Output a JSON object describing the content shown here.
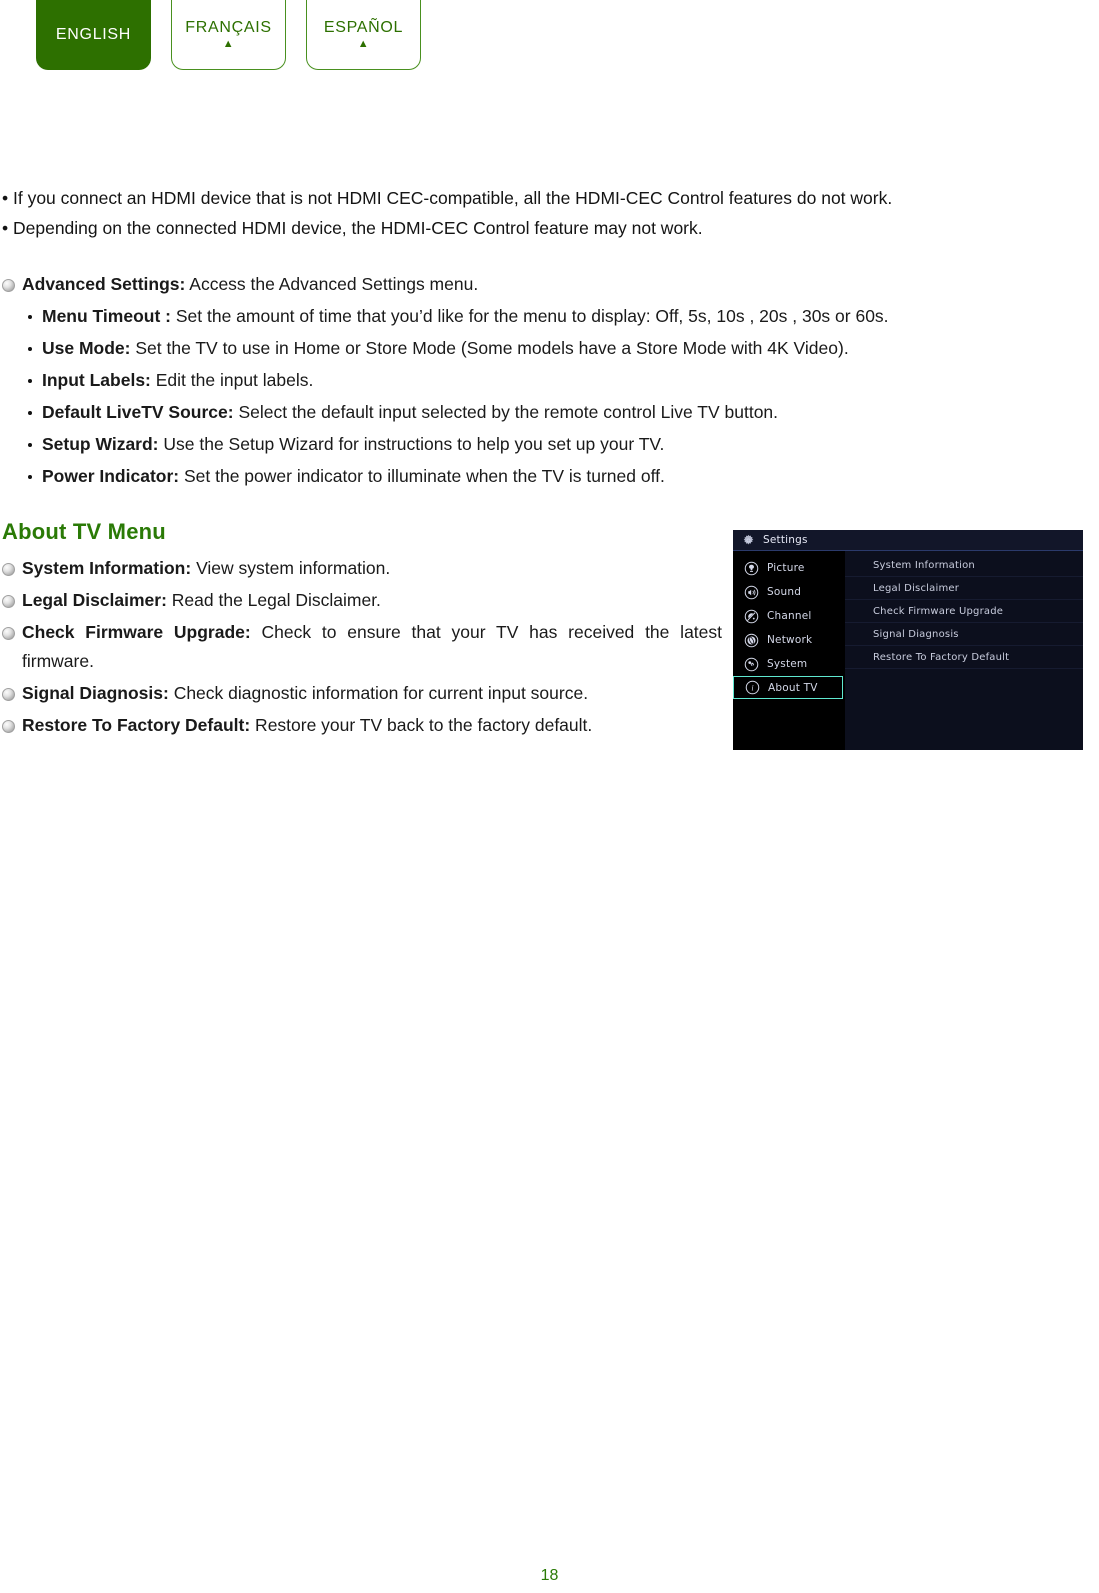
{
  "language_tabs": [
    {
      "label": "ENGLISH",
      "active": true,
      "arrow": ""
    },
    {
      "label": "FRANÇAIS",
      "active": false,
      "arrow": "▲"
    },
    {
      "label": "ESPAÑOL",
      "active": false,
      "arrow": "▲"
    }
  ],
  "notes": [
    "• If you connect an HDMI device that is not HDMI CEC-compatible, all the HDMI-CEC Control features do not work.",
    "• Depending on the connected HDMI device, the HDMI-CEC Control feature may not work."
  ],
  "advanced_settings": {
    "term": "Advanced Settings:",
    "description": " Access the Advanced Settings menu.",
    "sub_items": [
      {
        "term": "Menu Timeout :",
        "description": " Set the amount of time that you’d like for the menu to display: Off, 5s, 10s , 20s , 30s or 60s."
      },
      {
        "term": "Use Mode:",
        "description": " Set the TV to use in Home or Store Mode (Some models have a Store Mode with 4K Video)."
      },
      {
        "term": "Input Labels:",
        "description": " Edit the input labels."
      },
      {
        "term": "Default LiveTV Source:",
        "description": " Select the default input selected by the remote control Live TV button."
      },
      {
        "term": "Setup Wizard:",
        "description": " Use the Setup Wizard for instructions to help you set up your TV."
      },
      {
        "term": "Power Indicator:",
        "description": " Set the power indicator to illuminate when the TV is turned off."
      }
    ]
  },
  "about_tv_section": {
    "title": "About TV Menu",
    "items": [
      {
        "term": "System Information:",
        "description": " View system information."
      },
      {
        "term": "Legal Disclaimer:",
        "description": " Read the Legal Disclaimer."
      },
      {
        "term": "Check Firmware Upgrade:",
        "description": " Check to ensure that your TV has received the latest firmware."
      },
      {
        "term": "Signal Diagnosis:",
        "description": "  Check diagnostic information for current input source."
      },
      {
        "term": "Restore To Factory Default:",
        "description": " Restore your TV back to the factory default."
      }
    ]
  },
  "tv_menu": {
    "header_title": "Settings",
    "header_icon": "gear-icon",
    "sidebar": [
      {
        "label": "Picture",
        "icon": "picture-icon",
        "selected": false
      },
      {
        "label": "Sound",
        "icon": "speaker-icon",
        "selected": false
      },
      {
        "label": "Channel",
        "icon": "satellite-dish-icon",
        "selected": false
      },
      {
        "label": "Network",
        "icon": "network-globe-icon",
        "selected": false
      },
      {
        "label": "System",
        "icon": "system-gear-icon",
        "selected": false
      },
      {
        "label": "About TV",
        "icon": "info-icon",
        "selected": true
      }
    ],
    "panel_items": [
      "System Information",
      "Legal Disclaimer",
      "Check Firmware Upgrade",
      "Signal Diagnosis",
      "Restore To Factory Default"
    ],
    "colors": {
      "highlight_border": "#5fe8d0",
      "header_bg": "#121629",
      "sidebar_bg": "#000000",
      "panel_bg": "#0c0f1d"
    }
  },
  "page_number": "18",
  "colors": {
    "brand_green": "#2d7000",
    "heading_green": "#2a7a06",
    "tab_border_green": "#49901f"
  }
}
